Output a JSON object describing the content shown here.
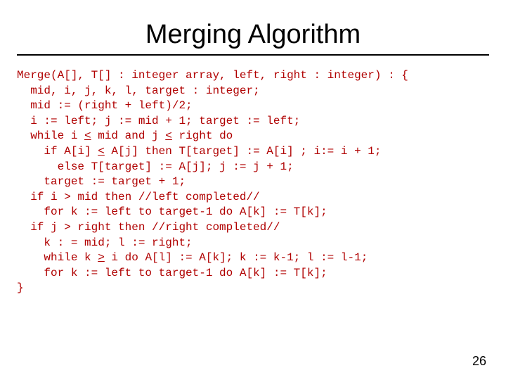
{
  "title": "Merging Algorithm",
  "code": {
    "l0": "Merge(A[], T[] : integer array, left, right : integer) : {",
    "l1": "  mid, i, j, k, l, target : integer;",
    "l2": "  mid := (right + left)/2;",
    "l3": "  i := left; j := mid + 1; target := left;",
    "l4a": "  while i ",
    "l4b": " mid and j ",
    "l4c": " right do",
    "l5a": "    if A[i] ",
    "l5b": " A[j] then T[target] := A[i] ; i:= i + 1;",
    "l6": "      else T[target] := A[j]; j := j + 1;",
    "l7": "    target := target + 1;",
    "l8": "  if i > mid then //left completed//",
    "l9": "    for k := left to target-1 do A[k] := T[k];",
    "l10": "  if j > right then //right completed//",
    "l11": "    k : = mid; l := right;",
    "l12a": "    while k ",
    "l12b": " i do A[l] := A[k]; k := k-1; l := l-1;",
    "l13": "    for k := left to target-1 do A[k] := T[k];",
    "l14": "}",
    "le": "<",
    "ge": ">"
  },
  "page_number": "26"
}
